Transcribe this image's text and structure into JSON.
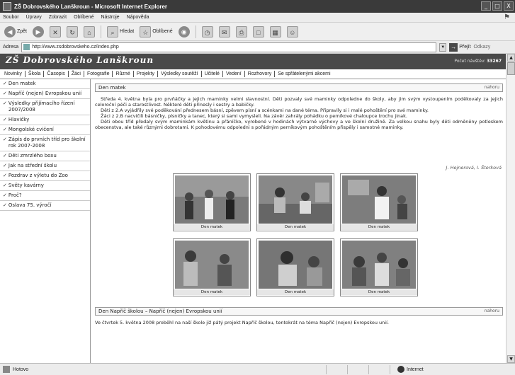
{
  "window": {
    "title": "ZŠ Dobrovského Lanškroun - Microsoft Internet Explorer",
    "buttons": [
      "_",
      "□",
      "X"
    ]
  },
  "menubar": {
    "items": [
      "Soubor",
      "Úpravy",
      "Zobrazit",
      "Oblíbené",
      "Nástroje",
      "Nápověda"
    ]
  },
  "toolbar": {
    "back_label": "Zpět",
    "search_label": "Hledat",
    "favorites_label": "Oblíbené"
  },
  "addressbar": {
    "label": "Adresa",
    "url": "http://www.zsdobrovskeho.cz/index.php",
    "go_label": "Přejít",
    "links_label": "Odkazy"
  },
  "site": {
    "title": "ZŠ Dobrovského Lanškroun",
    "visitors_label": "Počet návštěv:",
    "visitors_count": "33267"
  },
  "topnav": {
    "items": [
      "Novinky",
      "Škola",
      "Časopis",
      "Žáci",
      "Fotografie",
      "Různé",
      "Projekty",
      "Výsledky soutěží",
      "Učitelé",
      "Vedení",
      "Rozhovory",
      "Se spřátelenými akcemi"
    ]
  },
  "sidebar": {
    "items": [
      "Den matek",
      "Napříč (nejen) Evropskou unií",
      "Výsledky přijímacího řízení 2007/2008",
      "Hlavičky",
      "Mongolské cvičení",
      "Zápis do prvních tříd pro školní rok 2007-2008",
      "Děti zmrzlého boxu",
      "Jak na střední školu",
      "Pozdrav z výletu do Zoo",
      "Světy kavárny",
      "Proč?",
      "Oslava 75. výročí"
    ]
  },
  "article": {
    "title": "Den matek",
    "more_label": "nahoru",
    "paragraphs": [
      "Středa 4. května byla pro prvňáčky a jejich maminky velmi slavnostní. Děti pozvaly své maminky odpoledne do školy, aby jim svým vystoupením poděkovaly za jejich celoroční péči a starostlivost. Některé děti přinesly i sestry a babičky.",
      "Děti z 2.A vyjádřily své poděkování přednesem básní, zpěvem písní a scénkami na dané téma. Připravily si i malé pohoštění pro své maminky.",
      "Žáci z 2.B nacvičili básničky, písničky a tanec, který si sami vymysleli. Na závěr zahrály pohádku o perníkové chaloupce trochu jinak.",
      "Děti obou tříd předaly svým maminkám květinu a přáníčko, vyrobené v hodinách výtvarné výchovy a ve školní družině. Za velkou snahu byly děti odměněny potleskem obecenstva, ale také různými dobrotami. K pohodovému odpoledni s pořádným perníkovým pohoštěním přispěly i samotné maminky."
    ],
    "signature": "J. Hejnerová, I. Šterková"
  },
  "gallery": {
    "captions": [
      "Den matek",
      "Den matek",
      "Den matek",
      "Den matek",
      "Den matek",
      "Den matek"
    ]
  },
  "article2": {
    "title": "Den Napříč školou – Napříč (nejen) Evropskou unií",
    "more_label": "nahoru",
    "text": "Ve čtvrtek 5. května 2008 proběhl na naší škole již pátý projekt Napříč školou, tentokrát na téma Napříč (nejen) Evropskou unií."
  },
  "status": {
    "text": "Hotovo",
    "zone": "Internet"
  }
}
